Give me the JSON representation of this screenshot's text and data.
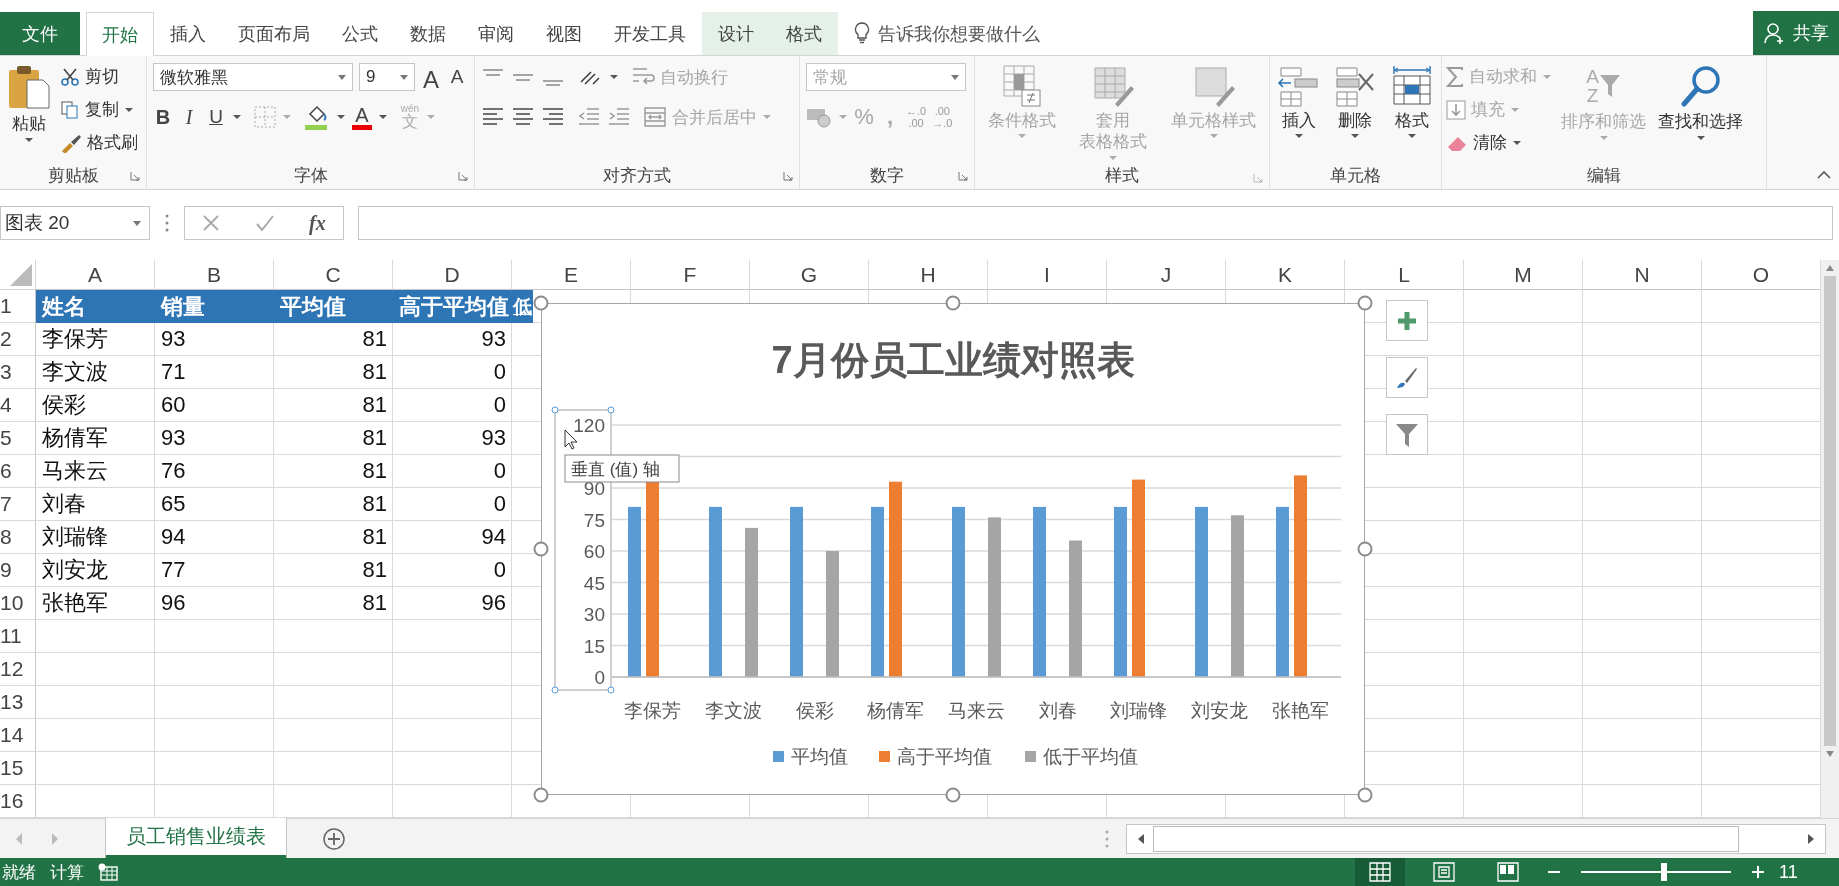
{
  "tabs": [
    {
      "label": "文件",
      "kind": "file",
      "selected": false
    },
    {
      "label": "开始",
      "kind": "tab",
      "selected": true
    },
    {
      "label": "插入",
      "kind": "tab",
      "selected": false
    },
    {
      "label": "页面布局",
      "kind": "tab",
      "selected": false
    },
    {
      "label": "公式",
      "kind": "tab",
      "selected": false
    },
    {
      "label": "数据",
      "kind": "tab",
      "selected": false
    },
    {
      "label": "审阅",
      "kind": "tab",
      "selected": false
    },
    {
      "label": "视图",
      "kind": "tab",
      "selected": false
    },
    {
      "label": "开发工具",
      "kind": "tab",
      "selected": false
    },
    {
      "label": "设计",
      "kind": "context",
      "selected": false
    },
    {
      "label": "格式",
      "kind": "context",
      "selected": false
    }
  ],
  "tell_me": {
    "placeholder": "告诉我你想要做什么"
  },
  "share": "共享",
  "ribbon": {
    "clipboard": {
      "label": "剪贴板",
      "paste": "粘贴",
      "cut": "剪切",
      "copy": "复制",
      "painter": "格式刷"
    },
    "font": {
      "label": "字体",
      "font_name": "微软雅黑",
      "font_size": "9",
      "grow": "A",
      "shrink": "A",
      "bold": "B",
      "italic": "I",
      "underline": "U",
      "font_color": "A",
      "phonetic_ruby": "wén",
      "phonetic": "文"
    },
    "alignment": {
      "label": "对齐方式",
      "wrap": {
        "label": "自动换行",
        "disabled": true
      },
      "merge": {
        "label": "合并后居中",
        "disabled": true
      }
    },
    "number": {
      "label": "数字",
      "format": {
        "value": "常规",
        "disabled": true
      },
      "percent": {
        "label": "%",
        "disabled": true
      },
      "comma": {
        "label": ",",
        "disabled": true
      },
      "increase_decimal": [
        "←.0",
        ".00"
      ],
      "decrease_decimal": [
        ".00",
        "→.0"
      ]
    },
    "styles": {
      "label": "样式",
      "commands": [
        {
          "lines": [
            "条件格式"
          ],
          "disabled": true
        },
        {
          "lines": [
            "套用",
            "表格格式"
          ],
          "disabled": true
        },
        {
          "lines": [
            "单元格样式"
          ],
          "disabled": true
        }
      ]
    },
    "cells": {
      "label": "单元格",
      "commands": [
        {
          "label": "插入",
          "disabled": false
        },
        {
          "label": "删除",
          "disabled": false
        },
        {
          "label": "格式",
          "disabled": false
        }
      ]
    },
    "editing": {
      "label": "编辑",
      "autosum": {
        "label": "自动求和",
        "disabled": true
      },
      "fill": {
        "label": "填充",
        "disabled": true
      },
      "clear": {
        "label": "清除",
        "disabled": false
      },
      "sort": {
        "label": "排序和筛选",
        "disabled": true,
        "letters": [
          "A",
          "Z"
        ]
      },
      "find": {
        "label": "查找和选择",
        "disabled": false
      }
    }
  },
  "formula_bar": {
    "name_box": "图表 20",
    "fx": "fx"
  },
  "columns": [
    "A",
    "B",
    "C",
    "D",
    "E",
    "F",
    "G",
    "H",
    "I",
    "J",
    "K",
    "L",
    "M",
    "N",
    "O"
  ],
  "rows": [
    {
      "number": "1",
      "kind": "header",
      "cells": [
        "姓名",
        "销量",
        "平均值",
        "高于平均值",
        "低"
      ]
    },
    {
      "number": "2",
      "kind": "data",
      "cells": [
        "李保芳",
        "93",
        "81",
        "93"
      ]
    },
    {
      "number": "3",
      "kind": "data",
      "cells": [
        "李文波",
        "71",
        "81",
        "0"
      ]
    },
    {
      "number": "4",
      "kind": "data",
      "cells": [
        "侯彩",
        "60",
        "81",
        "0"
      ]
    },
    {
      "number": "5",
      "kind": "data",
      "cells": [
        "杨倩军",
        "93",
        "81",
        "93"
      ]
    },
    {
      "number": "6",
      "kind": "data",
      "cells": [
        "马来云",
        "76",
        "81",
        "0"
      ]
    },
    {
      "number": "7",
      "kind": "data",
      "cells": [
        "刘春",
        "65",
        "81",
        "0"
      ]
    },
    {
      "number": "8",
      "kind": "data",
      "cells": [
        "刘瑞锋",
        "94",
        "81",
        "94"
      ]
    },
    {
      "number": "9",
      "kind": "data",
      "cells": [
        "刘安龙",
        "77",
        "81",
        "0"
      ]
    },
    {
      "number": "10",
      "kind": "data",
      "cells": [
        "张艳军",
        "96",
        "81",
        "96"
      ]
    },
    {
      "number": "11"
    },
    {
      "number": "12"
    },
    {
      "number": "13"
    },
    {
      "number": "14"
    },
    {
      "number": "15"
    },
    {
      "number": "16"
    }
  ],
  "chart": {
    "chart_data": {
      "type": "bar",
      "title": "7月份员工业绩对照表",
      "categories": [
        "李保芳",
        "李文波",
        "侯彩",
        "杨倩军",
        "马来云",
        "刘春",
        "刘瑞锋",
        "刘安龙",
        "张艳军"
      ],
      "series": [
        {
          "name": "平均值",
          "color": "#5b9bd5",
          "values": [
            81,
            81,
            81,
            81,
            81,
            81,
            81,
            81,
            81
          ]
        },
        {
          "name": "高于平均值",
          "color": "#ed7d31",
          "values": [
            93,
            0,
            0,
            93,
            0,
            0,
            94,
            0,
            96
          ]
        },
        {
          "name": "低于平均值",
          "color": "#a5a5a5",
          "values": [
            0,
            71,
            60,
            0,
            76,
            65,
            0,
            77,
            0
          ]
        }
      ],
      "ylim": [
        0,
        120
      ],
      "yticks": [
        0,
        15,
        30,
        45,
        60,
        75,
        90,
        120
      ],
      "grid": true,
      "legend": "bottom"
    },
    "tooltip": "垂直 (值) 轴"
  },
  "sheets": [
    {
      "label": "员工销售业绩表",
      "selected": true
    }
  ],
  "status": {
    "ready": "就绪",
    "calc": "计算",
    "views": [
      {
        "kind": "normal",
        "selected": true
      },
      {
        "kind": "page_layout",
        "selected": false
      },
      {
        "kind": "page_break",
        "selected": false
      }
    ],
    "zoom": {
      "level": 0.55,
      "label": "11"
    }
  }
}
